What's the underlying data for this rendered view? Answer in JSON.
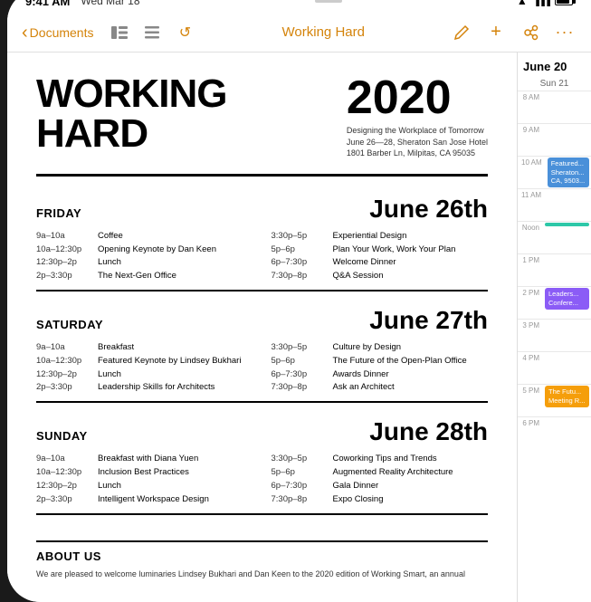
{
  "device": {
    "status_bar": {
      "time": "9:41 AM",
      "date": "Wed Mar 18",
      "icons": [
        "wifi",
        "battery"
      ]
    }
  },
  "toolbar": {
    "back_label": "Documents",
    "icon_sidebar": "⊞",
    "icon_list": "≡",
    "icon_history": "↺",
    "title": "Working Hard",
    "icon_pen": "✏",
    "icon_add": "+",
    "icon_share": "👥",
    "icon_more": "···"
  },
  "document": {
    "main_title_line1": "WORKING",
    "main_title_line2": "HARD",
    "year": "2020",
    "subtitle_line1": "Designing the Workplace of Tomorrow",
    "subtitle_line2": "June 26—28, Sheraton San Jose Hotel",
    "subtitle_line3": "1801 Barber Ln, Milpitas, CA 95035",
    "sections": [
      {
        "day": "FRIDAY",
        "date": "June 26th",
        "left_schedule": [
          {
            "time": "9a–10a",
            "desc": "Coffee"
          },
          {
            "time": "10a–12:30p",
            "desc": "Opening Keynote by Dan Keen"
          },
          {
            "time": "12:30p–2p",
            "desc": "Lunch"
          },
          {
            "time": "2p–3:30p",
            "desc": "The Next-Gen Office"
          }
        ],
        "right_schedule": [
          {
            "time": "3:30p–5p",
            "desc": "Experiential Design"
          },
          {
            "time": "5p–6p",
            "desc": "Plan Your Work, Work Your Plan"
          },
          {
            "time": "6p–7:30p",
            "desc": "Welcome Dinner"
          },
          {
            "time": "7:30p–8p",
            "desc": "Q&A Session"
          }
        ]
      },
      {
        "day": "SATURDAY",
        "date": "June 27th",
        "left_schedule": [
          {
            "time": "9a–10a",
            "desc": "Breakfast"
          },
          {
            "time": "10a–12:30p",
            "desc": "Featured Keynote by Lindsey Bukhari"
          },
          {
            "time": "12:30p–2p",
            "desc": "Lunch"
          },
          {
            "time": "2p–3:30p",
            "desc": "Leadership Skills for Architects"
          }
        ],
        "right_schedule": [
          {
            "time": "3:30p–5p",
            "desc": "Culture by Design"
          },
          {
            "time": "5p–6p",
            "desc": "The Future of the Open-Plan Office"
          },
          {
            "time": "6p–7:30p",
            "desc": "Awards Dinner"
          },
          {
            "time": "7:30p–8p",
            "desc": "Ask an Architect"
          }
        ]
      },
      {
        "day": "SUNDAY",
        "date": "June 28th",
        "left_schedule": [
          {
            "time": "9a–10a",
            "desc": "Breakfast with Diana Yuen"
          },
          {
            "time": "10a–12:30p",
            "desc": "Inclusion Best Practices"
          },
          {
            "time": "12:30p–2p",
            "desc": "Lunch"
          },
          {
            "time": "2p–3:30p",
            "desc": "Intelligent Workspace Design"
          }
        ],
        "right_schedule": [
          {
            "time": "3:30p–5p",
            "desc": "Coworking Tips and Trends"
          },
          {
            "time": "5p–6p",
            "desc": "Augmented Reality Architecture"
          },
          {
            "time": "6p–7:30p",
            "desc": "Gala Dinner"
          },
          {
            "time": "7:30p–8p",
            "desc": "Expo Closing"
          }
        ]
      }
    ],
    "about": {
      "title": "ABOUT US",
      "text": "We are pleased to welcome luminaries Lindsey Bukhari and Dan Keen to the 2020 edition of Working Smart, an annual"
    }
  },
  "calendar": {
    "month": "June 20",
    "day_label": "Sun 21",
    "time_slots": [
      {
        "label": "8 AM",
        "events": []
      },
      {
        "label": "9 AM",
        "events": []
      },
      {
        "label": "10 AM",
        "events": [
          {
            "title": "Featured... Sheraton... CA, 9503...",
            "color": "blue"
          }
        ]
      },
      {
        "label": "11 AM",
        "events": []
      },
      {
        "label": "Noon",
        "events": [
          {
            "title": "",
            "color": "teal"
          }
        ]
      },
      {
        "label": "1 PM",
        "events": []
      },
      {
        "label": "2 PM",
        "events": [
          {
            "title": "Leaders... Confere...",
            "color": "purple"
          }
        ]
      },
      {
        "label": "3 PM",
        "events": []
      },
      {
        "label": "4 PM",
        "events": []
      },
      {
        "label": "5 PM",
        "events": [
          {
            "title": "The Futu... Meeting R...",
            "color": "orange"
          }
        ]
      },
      {
        "label": "6 PM",
        "events": []
      }
    ]
  }
}
